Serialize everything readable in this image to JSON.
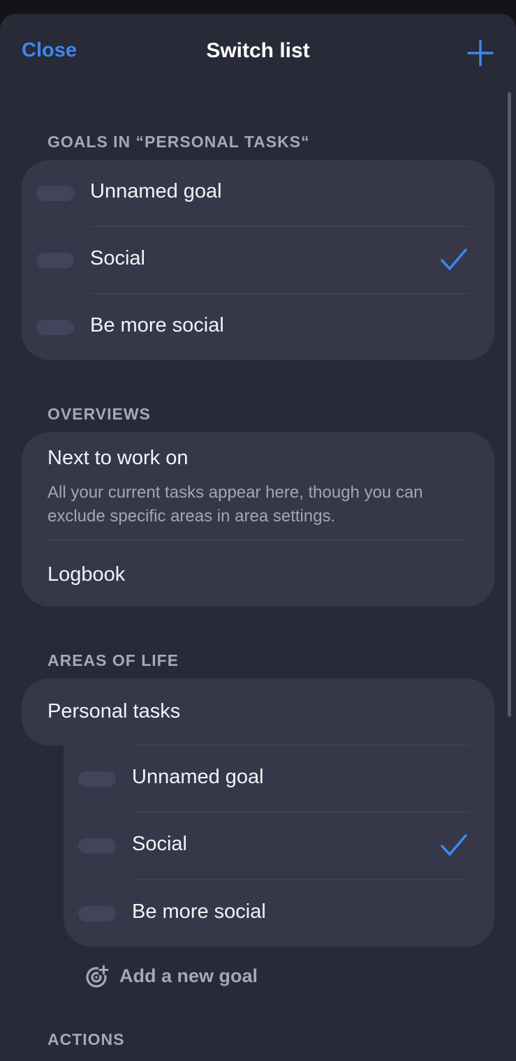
{
  "nav": {
    "close_label": "Close",
    "title": "Switch list",
    "add_icon": "plus-icon"
  },
  "goals_section": {
    "header": "GOALS IN “PERSONAL TASKS“",
    "items": [
      {
        "label": "Unnamed goal",
        "checked": false
      },
      {
        "label": "Social",
        "checked": true
      },
      {
        "label": "Be more social",
        "checked": false
      }
    ]
  },
  "overviews_section": {
    "header": "OVERVIEWS",
    "items": [
      {
        "label": "Next to work on",
        "description": "All your current tasks appear here, though you can exclude specific areas in area settings."
      },
      {
        "label": "Logbook"
      }
    ]
  },
  "areas_section": {
    "header": "AREAS OF LIFE",
    "area": {
      "label": "Personal tasks",
      "goals": [
        {
          "label": "Unnamed goal",
          "checked": false
        },
        {
          "label": "Social",
          "checked": true
        },
        {
          "label": "Be more social",
          "checked": false
        }
      ]
    },
    "add_goal_label": "Add a new goal"
  },
  "actions_section": {
    "header": "ACTIONS"
  },
  "colors": {
    "accent": "#3d87f0",
    "sheet_background": "#282a37",
    "card_background": "#363849"
  }
}
